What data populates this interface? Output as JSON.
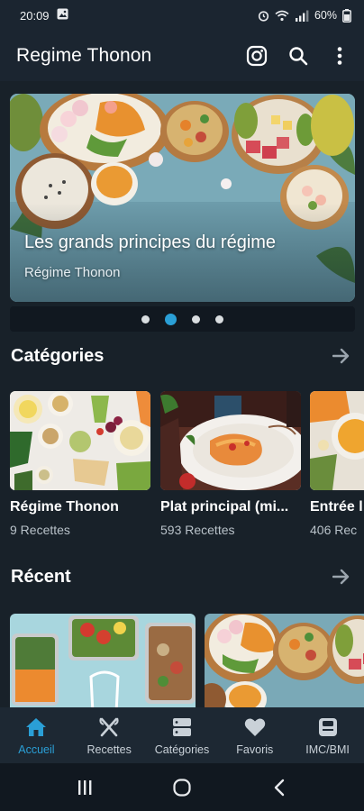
{
  "status_bar": {
    "time": "20:09",
    "battery": "60%"
  },
  "app_bar": {
    "title": "Regime Thonon",
    "icons": [
      "instagram-icon",
      "search-icon",
      "more-vert-icon"
    ]
  },
  "hero": {
    "title": "Les grands principes du régime",
    "subtitle": "Régime Thonon",
    "page_count": 4,
    "active_page": 1
  },
  "categories_section": {
    "title": "Catégories",
    "items": [
      {
        "name": "Régime Thonon",
        "count": "9 Recettes"
      },
      {
        "name": "Plat principal (mi...",
        "count": "593 Recettes"
      },
      {
        "name": "Entrée l",
        "count": "406 Rec"
      }
    ]
  },
  "recent_section": {
    "title": "Récent"
  },
  "bottom_nav": {
    "items": [
      {
        "label": "Accueil",
        "icon": "home-icon",
        "active": true
      },
      {
        "label": "Recettes",
        "icon": "utensils-icon",
        "active": false
      },
      {
        "label": "Catégories",
        "icon": "server-icon",
        "active": false
      },
      {
        "label": "Favoris",
        "icon": "heart-icon",
        "active": false
      },
      {
        "label": "IMC/BMI",
        "icon": "scale-icon",
        "active": false
      }
    ]
  },
  "colors": {
    "background": "#182129",
    "accent": "#2a9fd6",
    "nav_background": "#1d2833"
  }
}
